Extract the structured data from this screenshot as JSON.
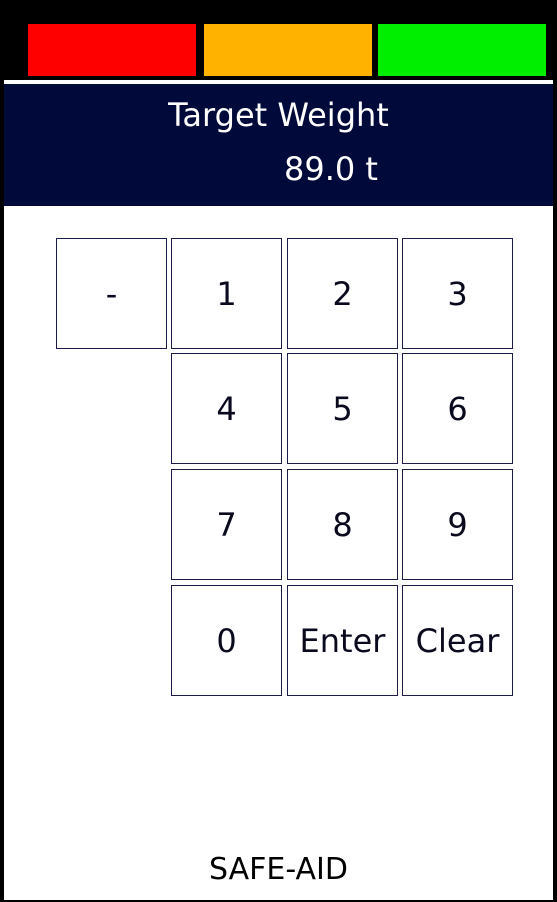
{
  "status_bar": {
    "segments": [
      {
        "color": "#ff0000"
      },
      {
        "color": "#ffb300"
      },
      {
        "color": "#00ee00"
      }
    ]
  },
  "header": {
    "title": "Target Weight",
    "value": "89.0 t"
  },
  "keypad": {
    "minus": "-",
    "one": "1",
    "two": "2",
    "three": "3",
    "four": "4",
    "five": "5",
    "six": "6",
    "seven": "7",
    "eight": "8",
    "nine": "9",
    "zero": "0",
    "enter": "Enter",
    "clear": "Clear"
  },
  "footer": {
    "brand": "SAFE-AID"
  }
}
